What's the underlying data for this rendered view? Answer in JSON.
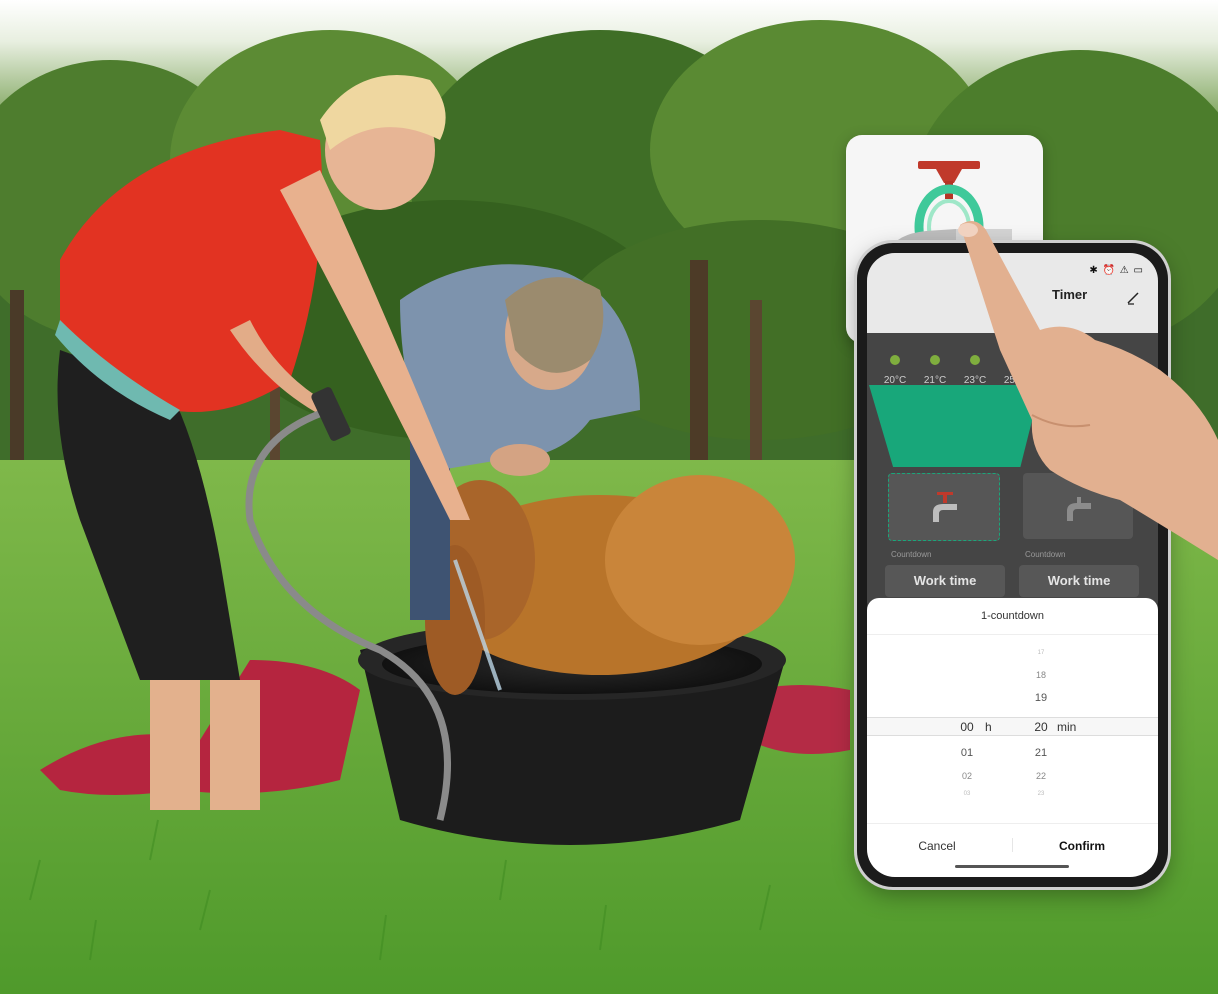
{
  "app": {
    "title": "Timer",
    "status_icons": "✱ ⏰ ⚠ ▭"
  },
  "temperatures": [
    "20°C",
    "21°C",
    "23°C",
    "25°C"
  ],
  "tiles": {
    "countdown_label": "Countdown",
    "work_time_label": "Work time"
  },
  "countdown_sheet": {
    "title": "1-countdown",
    "hours": {
      "above": [
        "",
        ""
      ],
      "selected": "00",
      "below": [
        "01",
        "02",
        "03"
      ],
      "unit": "h"
    },
    "minutes": {
      "above": [
        "17",
        "18",
        "19"
      ],
      "selected": "20",
      "below": [
        "21",
        "22",
        "23"
      ],
      "unit": "min"
    },
    "cancel_label": "Cancel",
    "confirm_label": "Confirm"
  },
  "colors": {
    "accent_green": "#18a77a",
    "valve_handle_red": "#c0392b",
    "temp_dot_green": "#7fae3e"
  },
  "icons": {
    "tap_card": "water-tap-icon",
    "tile": "water-tap-icon",
    "edit": "pencil-icon"
  }
}
